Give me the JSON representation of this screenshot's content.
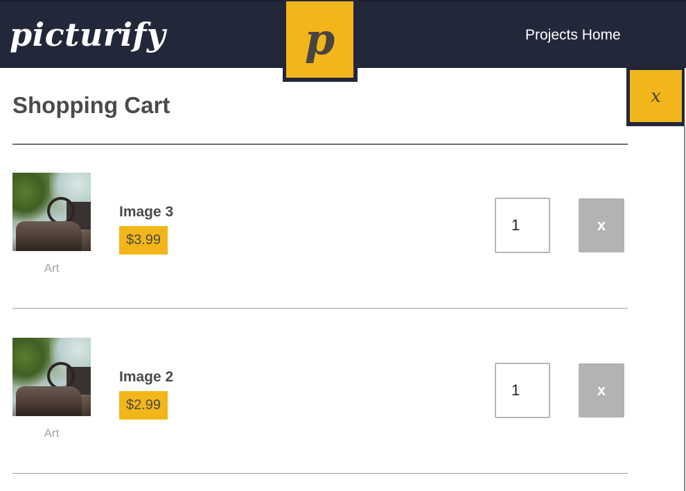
{
  "header": {
    "brand": "picturify",
    "logo_letter": "p",
    "nav_link": "Projects Home"
  },
  "cart": {
    "title": "Shopping Cart",
    "close_label": "x",
    "items": [
      {
        "name": "Image 3",
        "price": "$3.99",
        "category": "Art",
        "quantity": "1",
        "remove_label": "x"
      },
      {
        "name": "Image 2",
        "price": "$2.99",
        "category": "Art",
        "quantity": "1",
        "remove_label": "x"
      }
    ]
  },
  "colors": {
    "header_bg": "#23273a",
    "accent": "#f2b61a",
    "remove_button": "#b3b3b3"
  }
}
